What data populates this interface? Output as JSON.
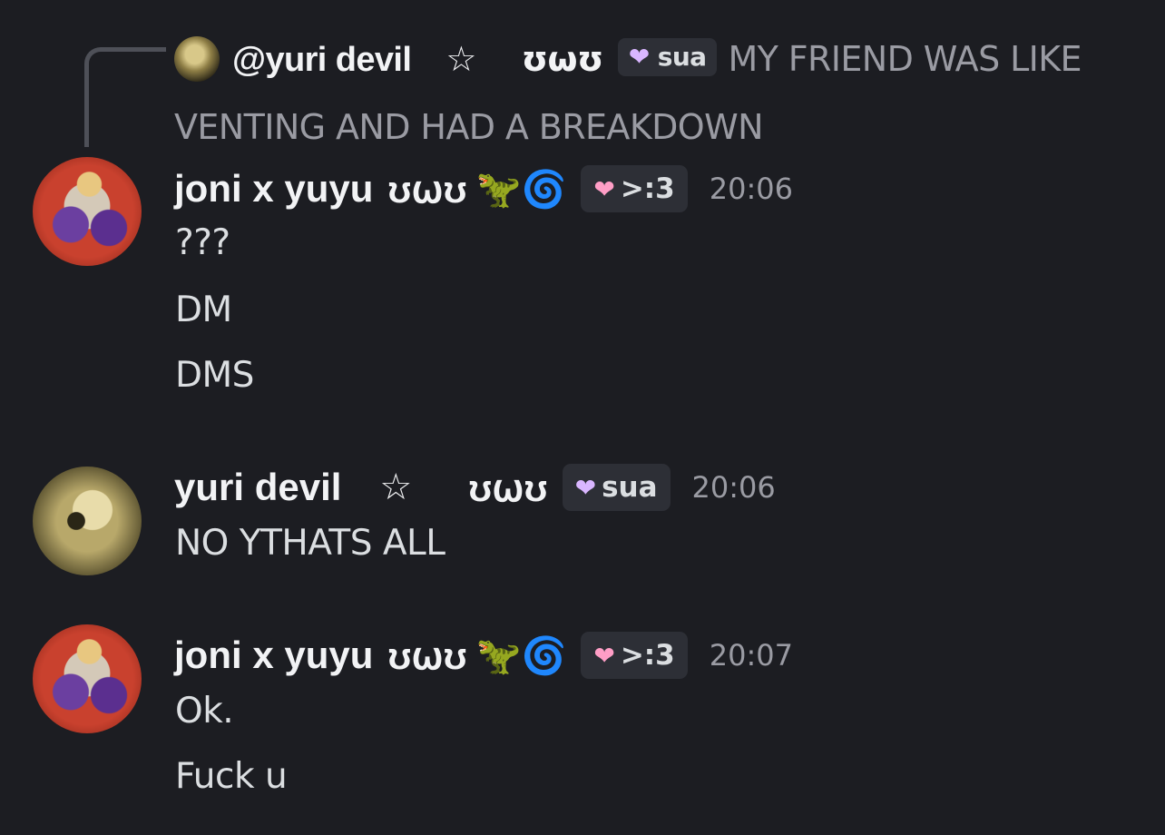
{
  "reply_ref": {
    "author": "@yuri devil",
    "star": "☆",
    "face": "ʊ⍵ʊ",
    "tag": "sua",
    "text_line1": "MY FRIEND WAS LIKE",
    "text_line2": "VENTING AND HAD A BREAKDOWN"
  },
  "messages": [
    {
      "author": "joni x yuyu",
      "face": "ʊ⍵ʊ",
      "emoji1": "🦖",
      "emoji2": "🌀",
      "badge": ">:3",
      "time": "20:06",
      "lines": [
        "???",
        "DM",
        "DMS"
      ]
    },
    {
      "author": "yuri devil",
      "star": "☆",
      "face": "ʊ⍵ʊ",
      "badge": "sua",
      "time": "20:06",
      "lines": [
        "NO YTHATS ALL"
      ]
    },
    {
      "author": "joni x yuyu",
      "face": "ʊ⍵ʊ",
      "emoji1": "🦖",
      "emoji2": "🌀",
      "badge": ">:3",
      "time": "20:07",
      "lines": [
        "Ok.",
        "Fuck u"
      ]
    }
  ],
  "icons": {
    "heart_pink": "pink-heart-icon",
    "heart_lilac": "lilac-heart-icon"
  },
  "colors": {
    "background": "#1c1d22",
    "username": "#f2f3f5",
    "muted": "#9a9ba3",
    "badge_bg": "#2d2f36"
  }
}
